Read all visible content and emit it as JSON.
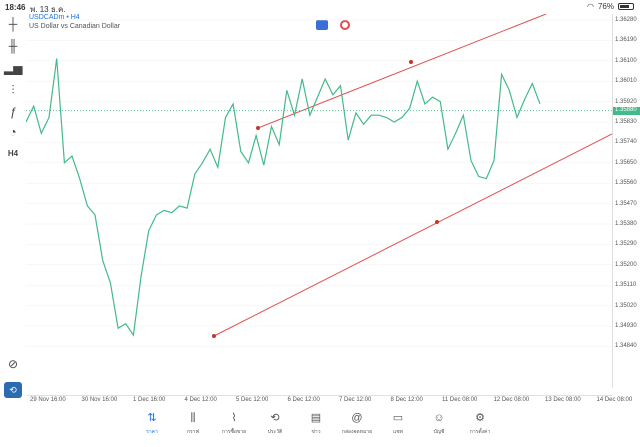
{
  "status": {
    "time": "18:46",
    "date": "พ. 13 ธ.ค.",
    "battery_text": "76%",
    "battery_level": 0.76
  },
  "symbol": {
    "name": "USDCADm • H4",
    "description": "US Dollar vs Canadian Dollar"
  },
  "toolbar": {
    "timeframe_label": "H4"
  },
  "price_axis": {
    "labels": [
      "1.36280",
      "1.36190",
      "1.36100",
      "1.36010",
      "1.35920",
      "1.35830",
      "1.35740",
      "1.35650",
      "1.35560",
      "1.35470",
      "1.35380",
      "1.35290",
      "1.35200",
      "1.35110",
      "1.35020",
      "1.34930",
      "1.34840"
    ],
    "current_price": "1.35880"
  },
  "time_axis": {
    "labels": [
      "29 Nov 16:00",
      "30 Nov 16:00",
      "1 Dec 16:00",
      "4 Dec 12:00",
      "5 Dec 12:00",
      "6 Dec 12:00",
      "7 Dec 12:00",
      "8 Dec 12:00",
      "11 Dec 08:00",
      "12 Dec 08:00",
      "13 Dec 08:00",
      "14 Dec 08:00"
    ]
  },
  "chart_data": {
    "type": "line",
    "ylim": [
      1.3482,
      1.3632
    ],
    "series": [
      {
        "values": [
          1.3583,
          1.359,
          1.3578,
          1.3585,
          1.3611,
          1.3565,
          1.3568,
          1.3558,
          1.3546,
          1.3542,
          1.3522,
          1.3512,
          1.3492,
          1.3494,
          1.3489,
          1.3515,
          1.3535,
          1.3542,
          1.3544,
          1.3543,
          1.3546,
          1.3545,
          1.356,
          1.3565,
          1.3571,
          1.3563,
          1.3585,
          1.3591,
          1.357,
          1.3565,
          1.3577,
          1.3564,
          1.3581,
          1.3573,
          1.3597,
          1.3586,
          1.3602,
          1.3586,
          1.3594,
          1.3602,
          1.3595,
          1.3599,
          1.3575,
          1.3587,
          1.3582,
          1.3586,
          1.3586,
          1.3585,
          1.3583,
          1.3585,
          1.3589,
          1.3601,
          1.3591,
          1.3594,
          1.3592,
          1.3571,
          1.3578,
          1.3586,
          1.3566,
          1.3559,
          1.3558,
          1.3566,
          1.3604,
          1.3597,
          1.3585,
          1.3593,
          1.36,
          1.3591
        ]
      }
    ],
    "current_price": 1.3588
  },
  "nav": [
    {
      "icon": "⇅",
      "label": "ราคา"
    },
    {
      "icon": "⫼",
      "label": "กราฟ"
    },
    {
      "icon": "⌇",
      "label": "การซื้อขาย"
    },
    {
      "icon": "⟲",
      "label": "ประวัติ"
    },
    {
      "icon": "▤",
      "label": "ข่าว"
    },
    {
      "icon": "@",
      "label": "กล่องจดหมาย"
    },
    {
      "icon": "▭",
      "label": "แชท"
    },
    {
      "icon": "☺",
      "label": "บัญชี"
    },
    {
      "icon": "⚙",
      "label": "การตั้งค่า"
    }
  ]
}
